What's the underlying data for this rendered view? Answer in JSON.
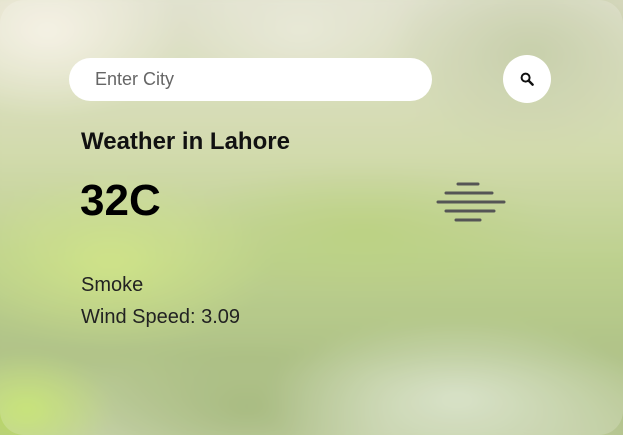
{
  "search": {
    "placeholder": "Enter City",
    "value": "",
    "button_icon": "search-icon"
  },
  "weather": {
    "title": "Weather in Lahore",
    "temperature": "32C",
    "icon": "haze-smoke-icon",
    "description": "Smoke",
    "wind": "Wind Speed: 3.09"
  },
  "colors": {
    "text_primary": "#111111",
    "card_overlay": "rgba(255,255,255,0.18)",
    "input_bg": "#ffffff",
    "icon_color": "#555555"
  }
}
